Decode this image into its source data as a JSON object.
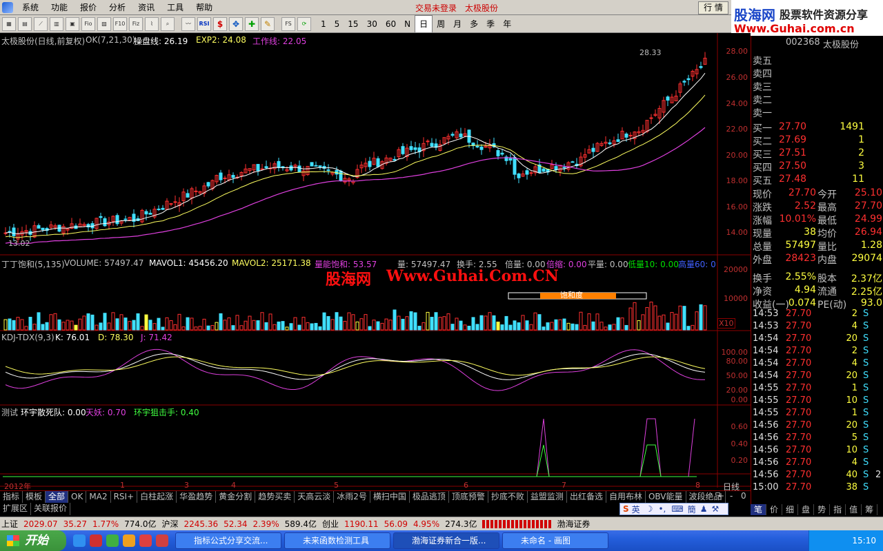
{
  "menu": {
    "items": [
      "系统",
      "功能",
      "报价",
      "分析",
      "资讯",
      "工具",
      "帮助"
    ],
    "trade_status": "交易未登录",
    "stock_link": "太极股份",
    "market_button": "行 情"
  },
  "logo": {
    "cn": "股海网",
    "tagline": "股票软件资源分享",
    "url": "Www.Guhai.com.cn"
  },
  "toolbar": {
    "periods": [
      "1",
      "5",
      "15",
      "30",
      "60",
      "N",
      "日",
      "周",
      "月",
      "多",
      "季",
      "年"
    ],
    "selected_period": "日",
    "icons": [
      "chart-icon",
      "grid-icon",
      "line-icon",
      "table-icon",
      "news-icon",
      "fund-icon",
      "f10-icon",
      "kline-icon",
      "fiz-icon",
      "f10b-icon",
      "search-icon",
      "trend-icon",
      "rsi-icon",
      "dollar-icon",
      "move-icon",
      "plus-icon",
      "pen-icon",
      "fs-icon",
      "refresh-icon"
    ],
    "icon_labels": {
      "rsi": "RSI",
      "fs": "FS",
      "fio": "Fio",
      "fiz": "Fiz",
      "f10": "F10"
    }
  },
  "main_pane": {
    "title": "太极股份(日线,前复权)",
    "indicator": "OK(7,21,30)",
    "line1_label": "操盘线: 26.19",
    "line2_label": "EXP2: 24.08",
    "line3_label": "工作线: 22.05",
    "high_label": "28.33",
    "low_label": "13.02",
    "axis": [
      "28.00",
      "26.00",
      "24.00",
      "22.00",
      "20.00",
      "18.00",
      "16.00",
      "14.00"
    ]
  },
  "vol_pane": {
    "title": "丁丁饱和(5,135)",
    "volume": "VOLUME: 57497.47",
    "mavol1": "MAVOL1: 45456.20",
    "mavol2": "MAVOL2: 25171.38",
    "qty_sat": "量能饱和: 53.57",
    "qty": "量: 57497.47",
    "turnover": "换手: 2.55",
    "bei": "倍量: 0.00",
    "beisuo": "倍缩: 0.00",
    "ping": "平量: 0.00",
    "di": "低量10: 0.00",
    "gao": "高量60: 0",
    "saturation_tag": "饱和度",
    "x10": "X10",
    "axis": [
      "20000",
      "10000"
    ]
  },
  "kdj_pane": {
    "title": "KDJ-TDX(9,3)",
    "k": "K: 76.01",
    "d": "D: 78.30",
    "j": "J: 71.42",
    "axis": [
      "100.00",
      "80.00",
      "50.00",
      "20.00",
      "0.00"
    ]
  },
  "test_pane": {
    "title": "测试",
    "line1": "环宇散死队: 0.00",
    "line2": "天妖: 0.70",
    "line3": "环宇狙击手: 0.40",
    "axis": [
      "0.60",
      "0.40",
      "0.20"
    ]
  },
  "watermark": {
    "cn": "股海网",
    "url": "Www.Guhai.Com.CN"
  },
  "time_axis": {
    "year": "2012年",
    "months": [
      "1",
      "3",
      "4",
      "5",
      "6",
      "7",
      "8"
    ],
    "period_label": "日线"
  },
  "quote": {
    "code": "002368",
    "name": "太极股份",
    "sells": [
      {
        "label": "卖五"
      },
      {
        "label": "卖四"
      },
      {
        "label": "卖三"
      },
      {
        "label": "卖二"
      },
      {
        "label": "卖一"
      }
    ],
    "buys": [
      {
        "label": "买一",
        "price": "27.70",
        "vol": "1491"
      },
      {
        "label": "买二",
        "price": "27.69",
        "vol": "1"
      },
      {
        "label": "买三",
        "price": "27.51",
        "vol": "2"
      },
      {
        "label": "买四",
        "price": "27.50",
        "vol": "3"
      },
      {
        "label": "买五",
        "price": "27.48",
        "vol": "11"
      }
    ],
    "stats": [
      {
        "l1": "现价",
        "v1": "27.70",
        "l2": "今开",
        "v2": "25.10"
      },
      {
        "l1": "涨跌",
        "v1": "2.52",
        "l2": "最高",
        "v2": "27.70"
      },
      {
        "l1": "涨幅",
        "v1": "10.01%",
        "l2": "最低",
        "v2": "24.99"
      },
      {
        "l1": "现量",
        "v1": "38",
        "l2": "均价",
        "v2": "26.94"
      },
      {
        "l1": "总量",
        "v1": "57497",
        "l2": "量比",
        "v2": "1.28"
      },
      {
        "l1": "外盘",
        "v1": "28423",
        "l2": "内盘",
        "v2": "29074"
      },
      {
        "l1": "换手",
        "v1": "2.55%",
        "l2": "股本",
        "v2": "2.37亿"
      },
      {
        "l1": "净资",
        "v1": "4.94",
        "l2": "流通",
        "v2": "2.25亿"
      },
      {
        "l1": "收益(一)",
        "v1": "0.074",
        "l2": "PE(动)",
        "v2": "93.0"
      }
    ],
    "ticks": [
      {
        "t": "14:53",
        "p": "27.70",
        "v": "2",
        "s": "S"
      },
      {
        "t": "14:53",
        "p": "27.70",
        "v": "4",
        "s": "S"
      },
      {
        "t": "14:54",
        "p": "27.70",
        "v": "20",
        "s": "S"
      },
      {
        "t": "14:54",
        "p": "27.70",
        "v": "2",
        "s": "S"
      },
      {
        "t": "14:54",
        "p": "27.70",
        "v": "4",
        "s": "S"
      },
      {
        "t": "14:54",
        "p": "27.70",
        "v": "20",
        "s": "S"
      },
      {
        "t": "14:55",
        "p": "27.70",
        "v": "1",
        "s": "S"
      },
      {
        "t": "14:55",
        "p": "27.70",
        "v": "10",
        "s": "S"
      },
      {
        "t": "14:55",
        "p": "27.70",
        "v": "1",
        "s": "S"
      },
      {
        "t": "14:56",
        "p": "27.70",
        "v": "20",
        "s": "S"
      },
      {
        "t": "14:56",
        "p": "27.70",
        "v": "5",
        "s": "S"
      },
      {
        "t": "14:56",
        "p": "27.70",
        "v": "10",
        "s": "S"
      },
      {
        "t": "14:56",
        "p": "27.70",
        "v": "4",
        "s": "S"
      },
      {
        "t": "14:56",
        "p": "27.70",
        "v": "40",
        "s": "S"
      },
      {
        "t": "15:00",
        "p": "27.70",
        "v": "38",
        "s": "S"
      }
    ],
    "tick_tail": "2"
  },
  "tabs": {
    "items": [
      "指标",
      "模板",
      "全部",
      "OK",
      "MA2",
      "RSI+",
      "白柱起涨",
      "华盈趋势",
      "黄金分割",
      "趋势买卖",
      "天高云淡",
      "冰雨2号",
      "横扫中国",
      "极品逃顶",
      "顶底预警",
      "抄底不败",
      "益盟监测",
      "出红备选",
      "自用布林",
      "OBV能量",
      "波段绝品"
    ],
    "selected": "全部",
    "row2": [
      "扩展区",
      "关联报价"
    ],
    "plus": "+",
    "minus": "-",
    "zero": "0"
  },
  "right_tabs": {
    "items": [
      "笔",
      "价",
      "细",
      "盘",
      "势",
      "指",
      "值",
      "筹"
    ],
    "selected": "笔"
  },
  "status": {
    "sh_label": "上证",
    "sh_val": "2029.07",
    "sh_chg": "35.27",
    "sh_pct": "1.77%",
    "sh_amt": "774.0亿",
    "sz_label": "沪深",
    "sz_val": "2245.36",
    "sz_chg": "52.34",
    "sz_pct": "2.39%",
    "sz_amt": "589.4亿",
    "cy_label": "创业",
    "cy_val": "1190.11",
    "cy_chg": "56.09",
    "cy_pct": "4.95%",
    "cy_amt": "274.3亿",
    "broker": "渤海证券"
  },
  "ime": {
    "label": "英"
  },
  "taskbar": {
    "start": "开始",
    "tasks": [
      "指标公式分享交流...",
      "未来函数检测工具",
      "渤海证券新合一版...",
      "未命名 - 画图"
    ],
    "time": "15:10"
  },
  "colors": {
    "up": "#ff3030",
    "down": "#40e0ff",
    "ma1": "#ffffff",
    "ma2": "#ffff60",
    "ma3": "#e040e0",
    "grid": "#8b0000"
  }
}
